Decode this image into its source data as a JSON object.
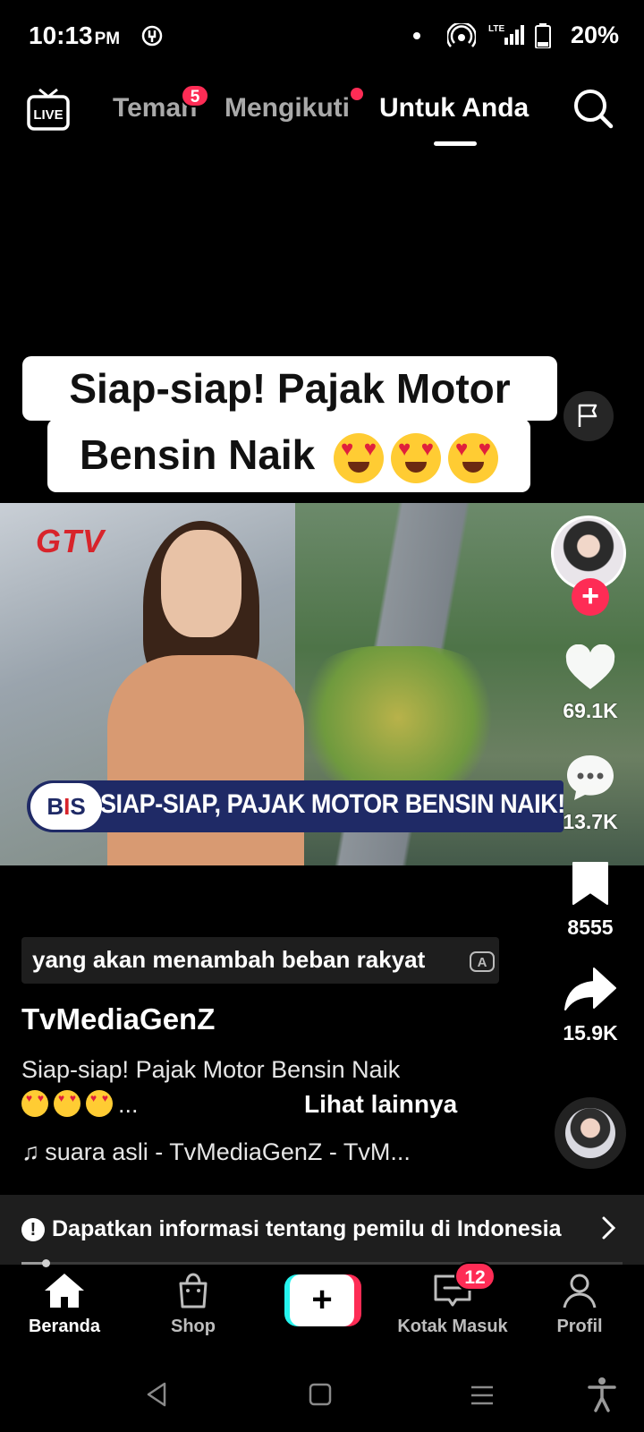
{
  "status_bar": {
    "time": "10:13",
    "ampm": "PM",
    "network": "LTE",
    "battery": "20%"
  },
  "top_nav": {
    "tabs": [
      {
        "label": "Teman",
        "badge": "5"
      },
      {
        "label": "Mengikuti"
      },
      {
        "label": "Untuk Anda",
        "active": true
      }
    ],
    "live_icon_label": "LIVE"
  },
  "video": {
    "overlay_caption_line1": "Siap-siap! Pajak Motor",
    "overlay_caption_line2": "Bensin Naik",
    "channel_logo": "GTV",
    "news_badge": "BIS",
    "news_ticker": "SIAP-SIAP, PAJAK MOTOR BENSIN NAIK!"
  },
  "actions": {
    "likes": "69.1K",
    "comments": "13.7K",
    "saves": "8555",
    "shares": "15.9K"
  },
  "post": {
    "subtitle": "yang akan menambah beban rakyat",
    "username": "TvMediaGenZ",
    "description_line1": "Siap-siap! Pajak Motor Bensin Naik",
    "description_suffix": "...",
    "see_more": "Lihat lainnya",
    "sound": "suara asli - TvMediaGenZ - TvM..."
  },
  "election_banner": {
    "icon": "!",
    "text": "Dapatkan informasi tentang pemilu di Indonesia"
  },
  "playback": {
    "progress_fraction": 0.04
  },
  "bottom_nav": {
    "home": "Beranda",
    "shop": "Shop",
    "create": "+",
    "inbox": "Kotak Masuk",
    "inbox_badge": "12",
    "profile": "Profil"
  },
  "colors": {
    "accent": "#fe2c55",
    "cyan": "#25f4ee",
    "background": "#000000"
  }
}
